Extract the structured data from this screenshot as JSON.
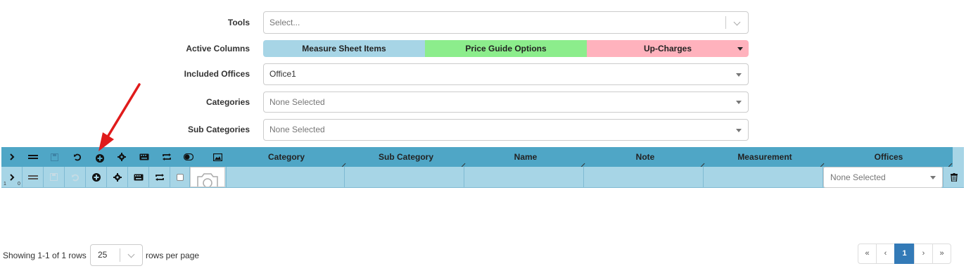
{
  "filters": {
    "tools": {
      "label": "Tools",
      "placeholder": "Select..."
    },
    "active_columns": {
      "label": "Active Columns",
      "segments": [
        {
          "label": "Measure Sheet Items",
          "color": "#a7d5e6"
        },
        {
          "label": "Price Guide Options",
          "color": "#8ced8c"
        },
        {
          "label": "Up-Charges",
          "color": "#ffb2bd"
        }
      ]
    },
    "included_offices": {
      "label": "Included Offices",
      "value": "Office1"
    },
    "categories": {
      "label": "Categories",
      "value": "None Selected"
    },
    "sub_categories": {
      "label": "Sub Categories",
      "value": "None Selected"
    }
  },
  "grid": {
    "header_color": "#4fa6c6",
    "row_color": "#a7d5e6",
    "header_icons": [
      "expand-icon",
      "drag-handle-icon",
      "save-icon",
      "undo-icon",
      "add-circle-icon",
      "gear-icon",
      "keyboard-icon",
      "repeat-icon",
      "toggle-icon",
      "image-icon"
    ],
    "columns": [
      "Category",
      "Sub Category",
      "Name",
      "Note",
      "Measurement",
      "Offices"
    ],
    "row": {
      "expander_counts": [
        "1",
        "0"
      ],
      "offices_placeholder": "None Selected"
    }
  },
  "pagination": {
    "showing_text": "Showing 1-1 of 1 rows",
    "page_size": "25",
    "rows_per_page_text": "rows per page",
    "first": "«",
    "prev": "‹",
    "current": "1",
    "next": "›",
    "last": "»",
    "accent": "#337ab7"
  }
}
